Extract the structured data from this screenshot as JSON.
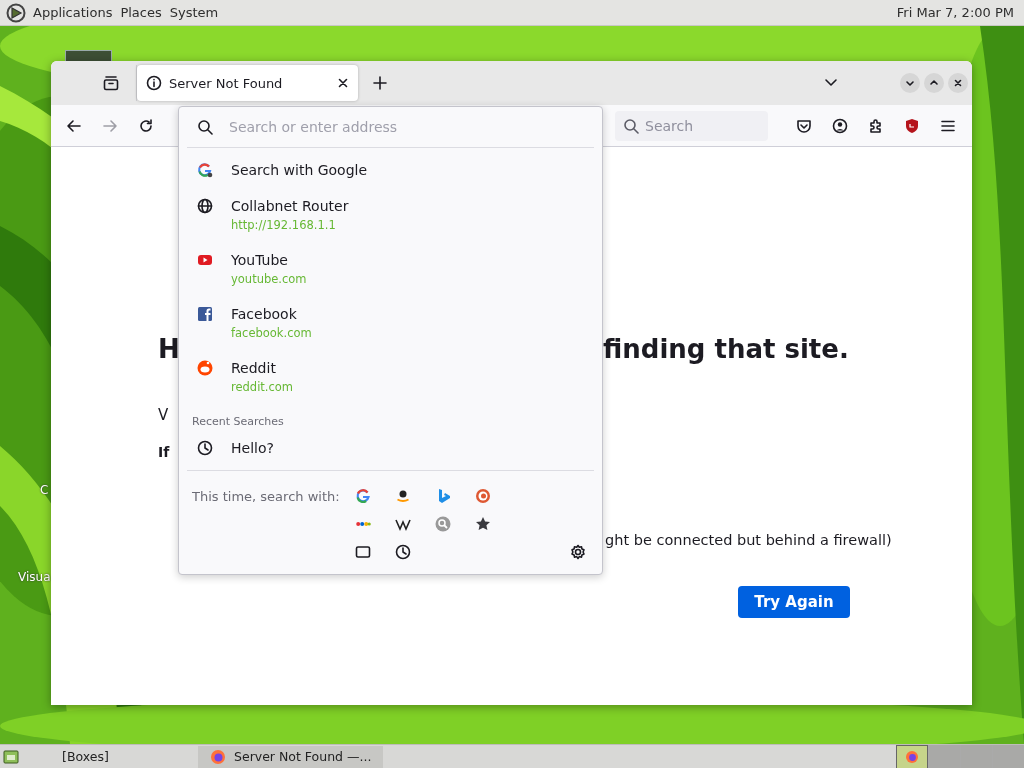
{
  "top_panel": {
    "menus": [
      "Applications",
      "Places",
      "System"
    ],
    "clock": "Fri Mar 7, 2:00 PM"
  },
  "desktop_icons": [
    {
      "label": "C"
    },
    {
      "label": "Visua"
    }
  ],
  "browser": {
    "tabs": [
      {
        "title": "Server Not Found",
        "selected": true
      }
    ],
    "nav_buttons": [
      {
        "kind": "back",
        "disabled": false
      },
      {
        "kind": "forward",
        "disabled": true
      },
      {
        "kind": "reload",
        "disabled": false
      }
    ],
    "search_field": {
      "placeholder": "Search"
    },
    "page": {
      "heading": [
        "H",
        "finding that site."
      ],
      "lines": [
        {
          "text": "V",
          "bold": false
        },
        {
          "text": "If",
          "bold": true
        }
      ],
      "hint_fragment": "ght be connected but behind a firewall)",
      "button": "Try Again"
    },
    "address_dropdown": {
      "placeholder": "Search or enter address",
      "results": [
        {
          "kind": "search",
          "title": "Search with Google"
        },
        {
          "kind": "globe",
          "title": "Collabnet Router",
          "url": "http://192.168.1.1"
        },
        {
          "kind": "video",
          "title": "YouTube",
          "url": "youtube.com"
        },
        {
          "kind": "square",
          "title": "Facebook",
          "url": "facebook.com"
        },
        {
          "kind": "round",
          "title": "Reddit",
          "url": "reddit.com"
        }
      ],
      "recent_heading": "Recent Searches",
      "recent": [
        {
          "text": "Hello?"
        }
      ],
      "engines_label": "This time, search with:"
    }
  },
  "taskbar": {
    "tasks": [
      {
        "kind": "plain",
        "label": "[Boxes]",
        "selected": false
      },
      {
        "kind": "browser",
        "label": "Server Not Found —...",
        "selected": true
      }
    ],
    "workspaces": [
      {
        "selected": true
      },
      {
        "selected": false
      },
      {
        "selected": false
      },
      {
        "selected": false
      }
    ]
  }
}
